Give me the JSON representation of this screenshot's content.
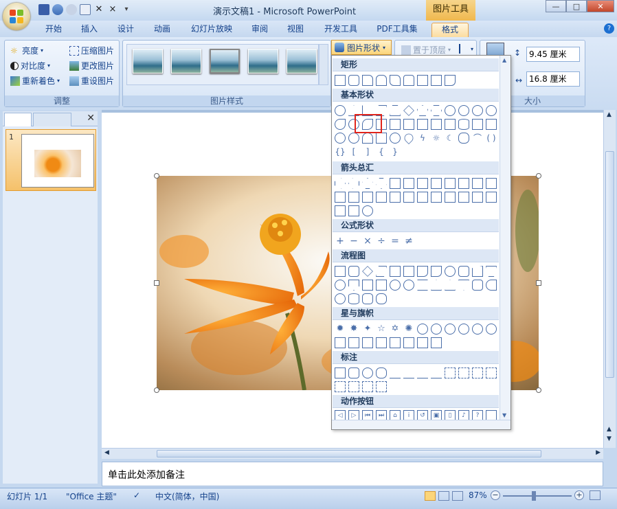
{
  "titlebar": {
    "window_title": "演示文稿1 - Microsoft PowerPoint",
    "context_title": "图片工具"
  },
  "tabs": [
    {
      "label": "开始"
    },
    {
      "label": "插入"
    },
    {
      "label": "设计"
    },
    {
      "label": "动画"
    },
    {
      "label": "幻灯片放映"
    },
    {
      "label": "审阅"
    },
    {
      "label": "视图"
    },
    {
      "label": "开发工具"
    },
    {
      "label": "PDF工具集"
    },
    {
      "label": "格式"
    }
  ],
  "ribbon": {
    "adjust": {
      "brightness": "亮度",
      "contrast": "对比度",
      "recolor": "重新着色",
      "compress": "压缩图片",
      "change": "更改图片",
      "reset": "重设图片",
      "group_label": "调整"
    },
    "styles": {
      "group_label": "图片样式"
    },
    "arrange": {
      "bring_front": "置于顶层"
    },
    "picture_shape": "图片形状",
    "size": {
      "height": "9.45 厘米",
      "width": "16.8 厘米",
      "group_label": "大小"
    }
  },
  "shape_menu": {
    "sections": [
      {
        "title": "矩形"
      },
      {
        "title": "基本形状"
      },
      {
        "title": "箭头总汇"
      },
      {
        "title": "公式形状"
      },
      {
        "title": "流程图"
      },
      {
        "title": "星与旗帜"
      },
      {
        "title": "标注"
      },
      {
        "title": "动作按钮"
      }
    ]
  },
  "left_pane": {
    "slide_number": "1"
  },
  "notes": {
    "placeholder": "单击此处添加备注"
  },
  "status": {
    "slide_info": "幻灯片 1/1",
    "theme": "\"Office 主题\"",
    "language": "中文(简体，中国)",
    "zoom": "87%"
  }
}
